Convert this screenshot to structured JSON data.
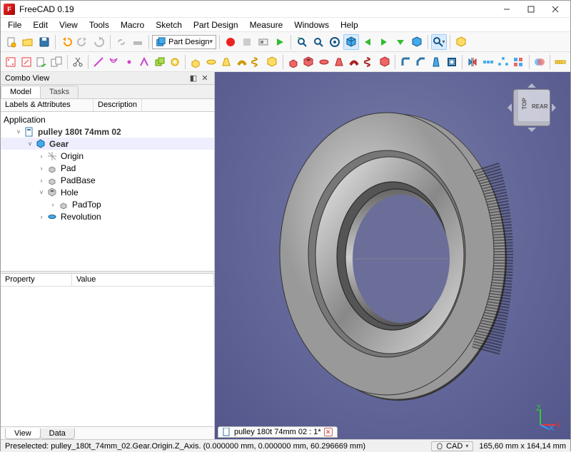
{
  "app": {
    "title": "FreeCAD 0.19"
  },
  "window_controls": {
    "min": "min",
    "max": "max",
    "close": "close"
  },
  "menubar": [
    "File",
    "Edit",
    "View",
    "Tools",
    "Macro",
    "Sketch",
    "Part Design",
    "Measure",
    "Windows",
    "Help"
  ],
  "workbench": {
    "label": "Part Design",
    "icon": "partdesign-icon"
  },
  "combo": {
    "panel_title": "Combo View",
    "tabs": [
      "Model",
      "Tasks"
    ],
    "active_tab": 0,
    "tree_header": {
      "col1": "Labels & Attributes",
      "col2": "Description"
    },
    "root_label": "Application",
    "tree": [
      {
        "level": 1,
        "expander": "˅",
        "icon": "doc-blue",
        "label": "pulley 180t 74mm 02",
        "bold": true
      },
      {
        "level": 2,
        "expander": "˅",
        "icon": "body-blue",
        "label": "Gear",
        "selected": true
      },
      {
        "level": 3,
        "expander": "›",
        "icon": "origin-grey",
        "label": "Origin"
      },
      {
        "level": 3,
        "expander": "›",
        "icon": "pad-grey",
        "label": "Pad"
      },
      {
        "level": 3,
        "expander": "›",
        "icon": "pad-grey",
        "label": "PadBase"
      },
      {
        "level": 3,
        "expander": "˅",
        "icon": "hole-blue",
        "label": "Hole"
      },
      {
        "level": 4,
        "expander": "›",
        "icon": "pad-grey",
        "label": "PadTop"
      },
      {
        "level": 3,
        "expander": "›",
        "icon": "rev-blue",
        "label": "Revolution"
      }
    ],
    "props_header": {
      "col1": "Property",
      "col2": "Value"
    },
    "bottom_tabs": [
      "View",
      "Data"
    ],
    "bottom_active": 0
  },
  "view3d": {
    "navcube": {
      "face1": "TOP",
      "face2": "REAR"
    },
    "tab": {
      "icon": "doc",
      "label": "pulley 180t 74mm 02 : 1*"
    }
  },
  "statusbar": {
    "preselected": "Preselected: pulley_180t_74mm_02.Gear.Origin.Z_Axis. (0.000000 mm, 0.000000 mm, 60.296669 mm)",
    "nav_style": "CAD",
    "dims": "165,60 mm x 164,14 mm"
  },
  "icons": {
    "row1_a": [
      "new",
      "open",
      "save",
      "sep",
      "undo",
      "redo",
      "refresh",
      "sep",
      "link",
      "hammer",
      "sep"
    ],
    "row1_c": [
      "sep",
      "rec-red",
      "stop",
      "cam",
      "play",
      "sep",
      "fit",
      "zoom",
      "zoom-all",
      "iso",
      "arrow-l",
      "arrow-r",
      "arrow-d",
      "box-blue",
      "sep",
      "mag",
      "drop",
      "sep",
      "shape"
    ],
    "row2": [
      "doc-red",
      "body-red",
      "print",
      "clone",
      "sep",
      "scissors",
      "sep",
      "line",
      "arc",
      "point",
      "profile",
      "poly",
      "gear-y",
      "sep",
      "pad-y",
      "pad2-y",
      "loft",
      "rev-y",
      "pipe",
      "helix",
      "sep",
      "pocket",
      "hole-r",
      "groove",
      "pipe-r",
      "helix-r",
      "sep",
      "fillet",
      "chamfer",
      "draft",
      "thick",
      "sep",
      "mirror",
      "linpat",
      "polpat",
      "sep",
      "bool",
      "sep",
      "measure"
    ]
  }
}
